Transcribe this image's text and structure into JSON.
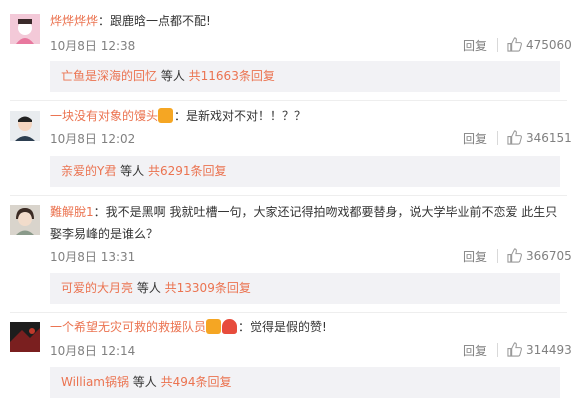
{
  "comments": [
    {
      "username": "烨烨烨烨",
      "text": "：跟鹿晗一点都不配!",
      "time": "10月8日 12:38",
      "reply_label": "回复",
      "likes": "475060",
      "sub": {
        "who": "亡鱼是深海的回忆",
        "mid": " 等人 ",
        "count": "共11663条回复"
      }
    },
    {
      "username": "一块没有对象的馒头",
      "text": "：是新戏对不对！！？？",
      "time": "10月8日 12:02",
      "reply_label": "回复",
      "likes": "346151",
      "sub": {
        "who": "亲爱的Y君",
        "mid": " 等人 ",
        "count": "共6291条回复"
      }
    },
    {
      "username": "難解脫1",
      "text": "：我不是黑啊 我就吐槽一句，大家还记得拍吻戏都要替身，说大学毕业前不恋爱 此生只娶李易峰的是谁么？",
      "time": "10月8日 13:31",
      "reply_label": "回复",
      "likes": "366705",
      "sub": {
        "who": "可爱的大月亮",
        "mid": " 等人 ",
        "count": "共13309条回复"
      }
    },
    {
      "username": "一个希望无灾可救的救援队员",
      "text": "：觉得是假的赞!",
      "time": "10月8日 12:14",
      "reply_label": "回复",
      "likes": "314493",
      "sub": {
        "who": "William锅锅",
        "mid": " 等人 ",
        "count": "共494条回复"
      }
    }
  ],
  "colors": {
    "accent": "#eb7350",
    "reply_bg": "#f2f2f5",
    "muted": "#808080"
  }
}
